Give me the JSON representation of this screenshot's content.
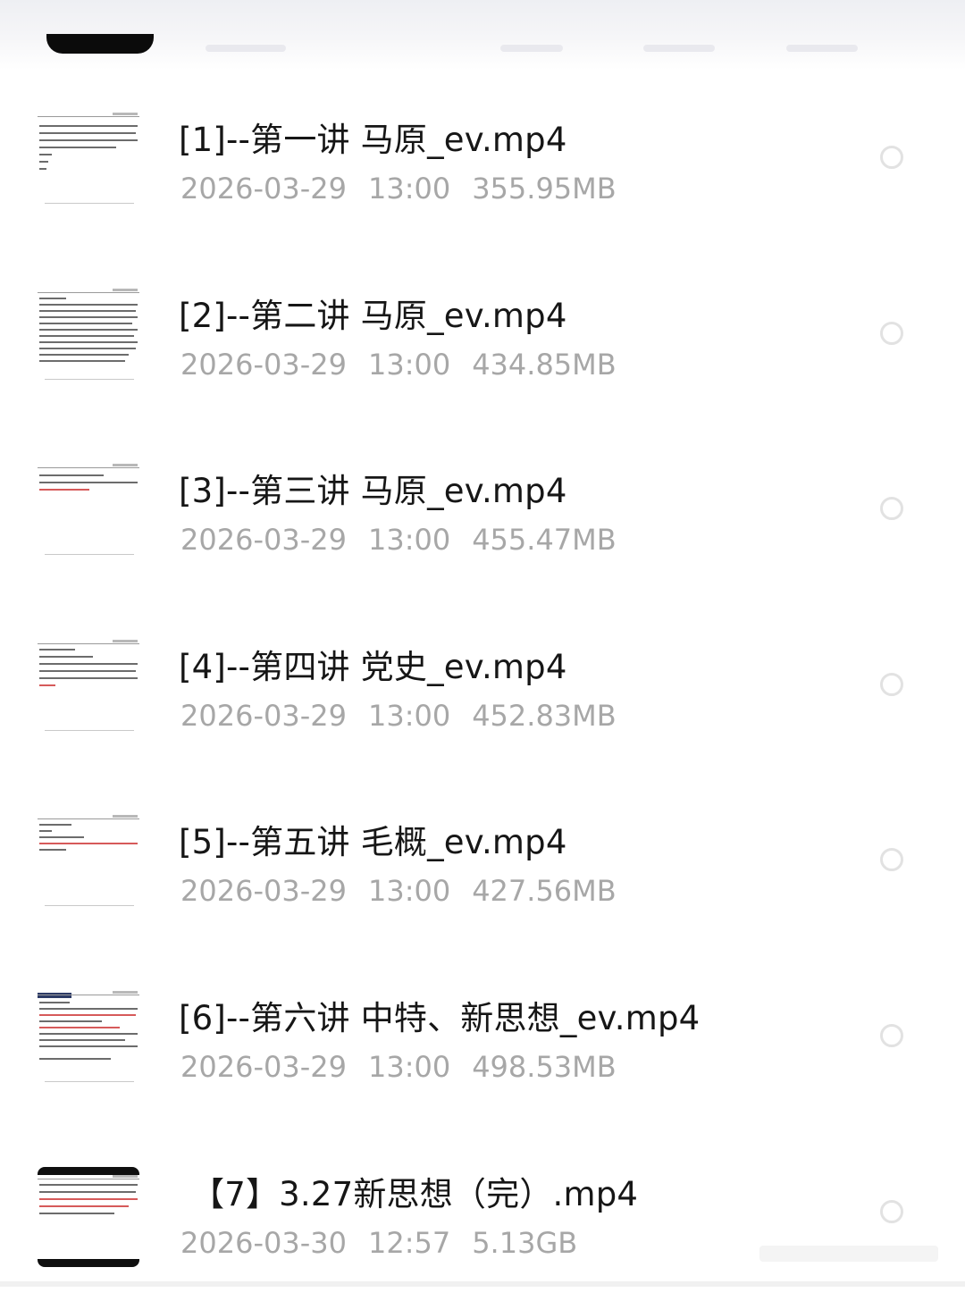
{
  "files": [
    {
      "name": "[1]--第一讲 马原_ev.mp4",
      "date": "2026-03-29",
      "time": "13:00",
      "size": "355.95MB",
      "thumb_icon": "document-thumbnail-icon"
    },
    {
      "name": "[2]--第二讲 马原_ev.mp4",
      "date": "2026-03-29",
      "time": "13:00",
      "size": "434.85MB",
      "thumb_icon": "document-thumbnail-icon"
    },
    {
      "name": "[3]--第三讲 马原_ev.mp4",
      "date": "2026-03-29",
      "time": "13:00",
      "size": "455.47MB",
      "thumb_icon": "document-thumbnail-icon"
    },
    {
      "name": "[4]--第四讲 党史_ev.mp4",
      "date": "2026-03-29",
      "time": "13:00",
      "size": "452.83MB",
      "thumb_icon": "document-thumbnail-icon"
    },
    {
      "name": "[5]--第五讲 毛概_ev.mp4",
      "date": "2026-03-29",
      "time": "13:00",
      "size": "427.56MB",
      "thumb_icon": "document-thumbnail-icon"
    },
    {
      "name": "[6]--第六讲 中特、新思想_ev.mp4",
      "date": "2026-03-29",
      "time": "13:00",
      "size": "498.53MB",
      "thumb_icon": "document-thumbnail-icon"
    },
    {
      "name": "【7】3.27新思想（完）.mp4",
      "date": "2026-03-30",
      "time": "12:57",
      "size": "5.13GB",
      "thumb_icon": "document-thumbnail-icon"
    }
  ],
  "colors": {
    "title": "#161616",
    "meta": "#a7a7a7",
    "radio_border": "#e2e2e2"
  }
}
